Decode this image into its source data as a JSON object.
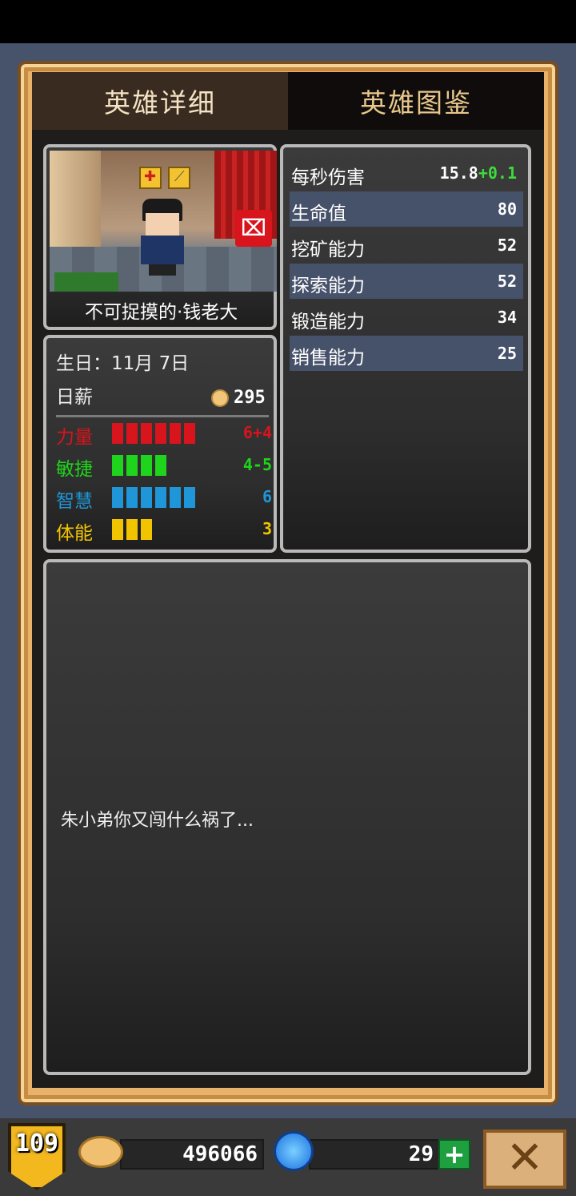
{
  "tabs": {
    "detail": "英雄详细",
    "atlas": "英雄图鉴"
  },
  "hero": {
    "name": "不可捉摸的·钱老大",
    "birthday": "生日：11月 7日",
    "salary_label": "日薪",
    "salary": "295",
    "attributes": [
      {
        "label": "力量",
        "bars": 6,
        "value": "6+4",
        "color": "#d8141c"
      },
      {
        "label": "敏捷",
        "bars": 4,
        "value": "4-5",
        "color": "#1fd41c"
      },
      {
        "label": "智慧",
        "bars": 6,
        "value": "6",
        "color": "#1f96d8"
      },
      {
        "label": "体能",
        "bars": 3,
        "value": "3",
        "color": "#f2c400"
      }
    ],
    "stats": [
      {
        "label": "每秒伤害",
        "value": "15.8",
        "bonus": "+0.1"
      },
      {
        "label": "生命值",
        "value": "80"
      },
      {
        "label": "挖矿能力",
        "value": "52"
      },
      {
        "label": "探索能力",
        "value": "52"
      },
      {
        "label": "锻造能力",
        "value": "34"
      },
      {
        "label": "销售能力",
        "value": "25"
      }
    ],
    "description": "朱小弟你又闯什么祸了..."
  },
  "bottom": {
    "level": "109",
    "gold": "496066",
    "gems": "29",
    "plus": "+",
    "close": "✕"
  },
  "colors": {
    "background": "#47536b",
    "frame": "#e8b26a",
    "bonus": "#3ddc3a"
  }
}
